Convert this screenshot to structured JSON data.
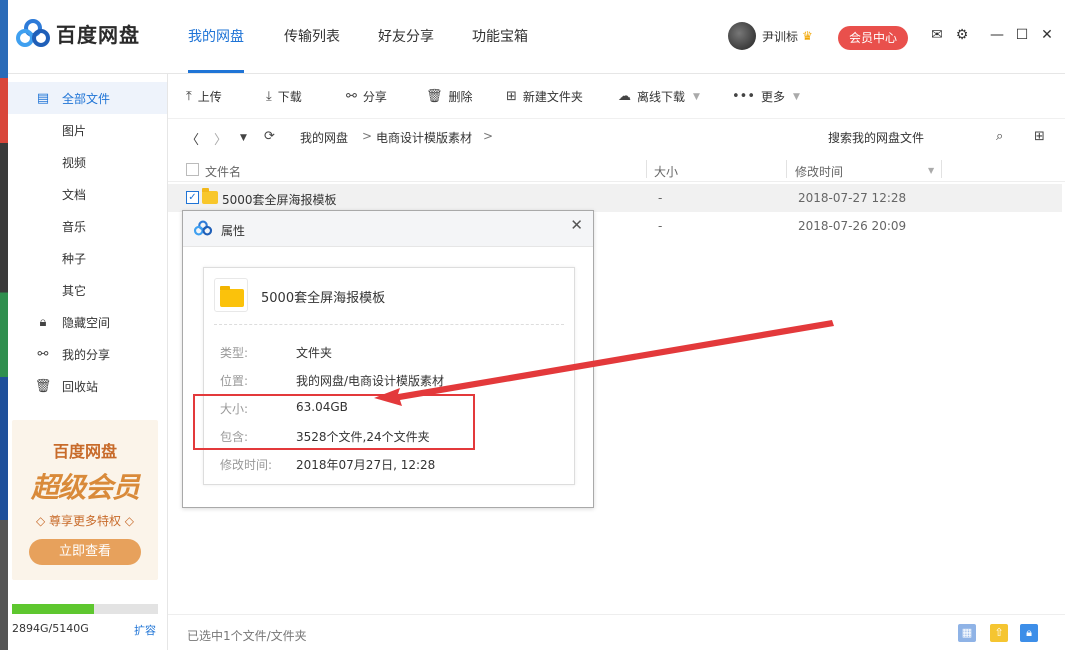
{
  "app": {
    "title": "百度网盘"
  },
  "nav": {
    "tabs": [
      "我的网盘",
      "传输列表",
      "好友分享",
      "功能宝箱"
    ],
    "active": "我的网盘"
  },
  "user": {
    "name": "尹训标",
    "vip_label": "会员中心"
  },
  "sidebar": {
    "items": [
      {
        "label": "全部文件",
        "icon": "file-icon"
      },
      {
        "label": "图片"
      },
      {
        "label": "视频"
      },
      {
        "label": "文档"
      },
      {
        "label": "音乐"
      },
      {
        "label": "种子"
      },
      {
        "label": "其它"
      },
      {
        "label": "隐藏空间",
        "icon": "lock-icon"
      },
      {
        "label": "我的分享",
        "icon": "share-icon"
      },
      {
        "label": "回收站",
        "icon": "trash-icon"
      }
    ],
    "promo": {
      "brand": "百度网盘",
      "title": "超级会员",
      "subtitle": "◇ 尊享更多特权 ◇",
      "button": "立即查看"
    },
    "quota": {
      "text": "2894G/5140G",
      "used_fraction": 0.563,
      "expand_label": "扩容"
    }
  },
  "toolbar": {
    "upload": "上传",
    "download": "下载",
    "share": "分享",
    "delete": "删除",
    "new_folder": "新建文件夹",
    "offline": "离线下载",
    "more": "更多"
  },
  "path": {
    "crumbs": [
      "我的网盘",
      "电商设计模版素材"
    ],
    "separator": ">",
    "search_placeholder": "搜索我的网盘文件"
  },
  "table": {
    "headers": {
      "name": "文件名",
      "size": "大小",
      "modified": "修改时间"
    },
    "rows": [
      {
        "name": "5000套全屏海报模板",
        "size": "-",
        "modified": "2018-07-27 12:28",
        "selected": true
      },
      {
        "name": "",
        "size": "-",
        "modified": "2018-07-26 20:09",
        "selected": false
      }
    ]
  },
  "status": {
    "text": "已选中1个文件/文件夹"
  },
  "dialog": {
    "title": "属性",
    "name": "5000套全屏海报模板",
    "props": [
      {
        "label": "类型:",
        "value": "文件夹"
      },
      {
        "label": "位置:",
        "value": "我的网盘/电商设计模版素材"
      },
      {
        "label": "大小:",
        "value": "63.04GB"
      },
      {
        "label": "包含:",
        "value": "3528个文件,24个文件夹"
      },
      {
        "label": "修改时间:",
        "value": "2018年07月27日, 12:28"
      }
    ]
  },
  "colors": {
    "accent": "#1f74d6",
    "vip": "#e9504c",
    "annotation": "#e3393b",
    "folder": "#f8c72b"
  }
}
